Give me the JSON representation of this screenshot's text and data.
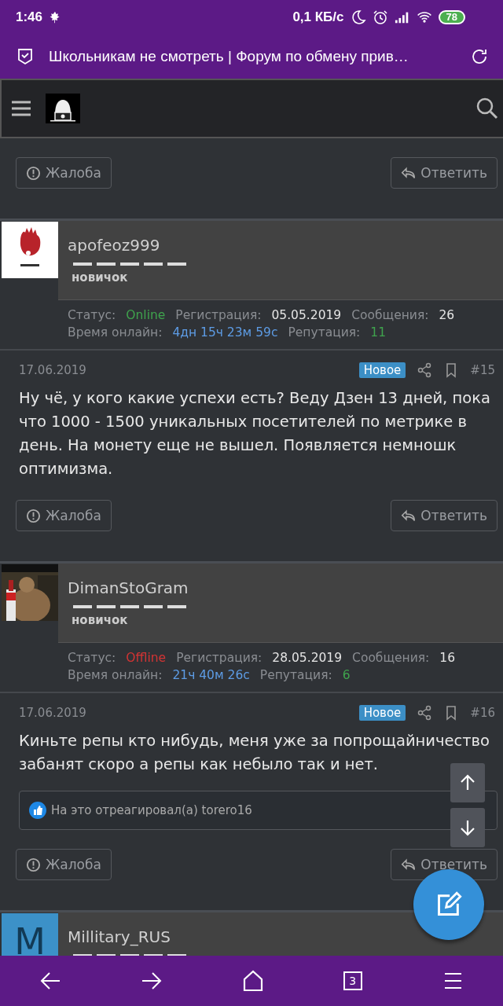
{
  "status_bar": {
    "time": "1:46",
    "speed": "0,1 КБ/с",
    "battery": "78"
  },
  "browser": {
    "title": "Школьникам не смотреть | Форум по обмену прив…"
  },
  "top_actions": {
    "report": "Жалоба",
    "reply": "Ответить"
  },
  "posts": [
    {
      "kind": "picture",
      "username": "apofeoz999",
      "rank": "новичок",
      "status_label": "Статус:",
      "status": "Online",
      "online": true,
      "reg_label": "Регистрация:",
      "reg": "05.05.2019",
      "msg_label": "Сообщения:",
      "msgs": "26",
      "time_label": "Время онлайн:",
      "time": "4дн 15ч 23м 59с",
      "rep_label": "Репутация:",
      "rep": "11",
      "date": "17.06.2019",
      "badge": "Новое",
      "number": "#15",
      "body": "Ну чё, у кого какие успехи есть? Веду Дзен 13 дней, пока что 1000 - 1500 уникальных посетителей по метрике в день. На монету еще не вышел. Появляется немношк оптимизма.",
      "report": "Жалоба",
      "reply": "Ответить"
    },
    {
      "kind": "picture",
      "username": "DimanStoGram",
      "rank": "новичок",
      "status_label": "Статус:",
      "status": "Offline",
      "online": false,
      "reg_label": "Регистрация:",
      "reg": "28.05.2019",
      "msg_label": "Сообщения:",
      "msgs": "16",
      "time_label": "Время онлайн:",
      "time": "21ч 40м 26с",
      "rep_label": "Репутация:",
      "rep": "6",
      "date": "17.06.2019",
      "badge": "Новое",
      "number": "#16",
      "body": "Киньте репы кто нибудь, меня уже за попрощайничество забанят скоро а репы как небыло так и нет.",
      "reaction": "На это отреагировал(а) torero16",
      "report": "Жалоба",
      "reply": "Ответить"
    },
    {
      "kind": "letter",
      "letter": "M",
      "username": "Millitary_RUS"
    }
  ],
  "bottom_nav": {
    "tabs": "3"
  }
}
